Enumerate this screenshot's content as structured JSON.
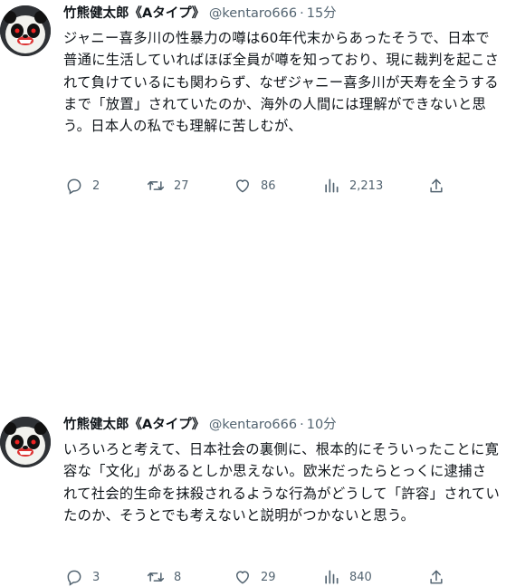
{
  "tweets": [
    {
      "name": "竹熊健太郎《Aタイプ》",
      "handle": "@kentaro666",
      "separator": "·",
      "time": "15分",
      "text": "ジャニー喜多川の性暴力の噂は60年代末からあったそうで、日本で普通に生活していればほぼ全員が噂を知っており、現に裁判を起こされて負けているにも関わらず、なぜジャニー喜多川が天寿を全うするまで「放置」されていたのか、海外の人間には理解ができないと思う。日本人の私でも理解に苦しむが、",
      "replies": "2",
      "retweets": "27",
      "likes": "86",
      "views": "2,213"
    },
    {
      "name": "竹熊健太郎《Aタイプ》",
      "handle": "@kentaro666",
      "separator": "·",
      "time": "10分",
      "text": "いろいろと考えて、日本社会の裏側に、根本的にそういったことに寛容な「文化」があるとしか思えない。欧米だったらとっくに逮捕されて社会的生命を抹殺されるような行為がどうして「許容」されていたのか、そうとでも考えないと説明がつかないと思う。",
      "replies": "3",
      "retweets": "8",
      "likes": "29",
      "views": "840"
    }
  ],
  "icons": {
    "reply": "reply-icon",
    "retweet": "retweet-icon",
    "like": "like-icon",
    "views": "views-icon",
    "share": "share-icon"
  },
  "colors": {
    "text": "#0f1419",
    "secondary": "#536471",
    "background": "#ffffff"
  }
}
